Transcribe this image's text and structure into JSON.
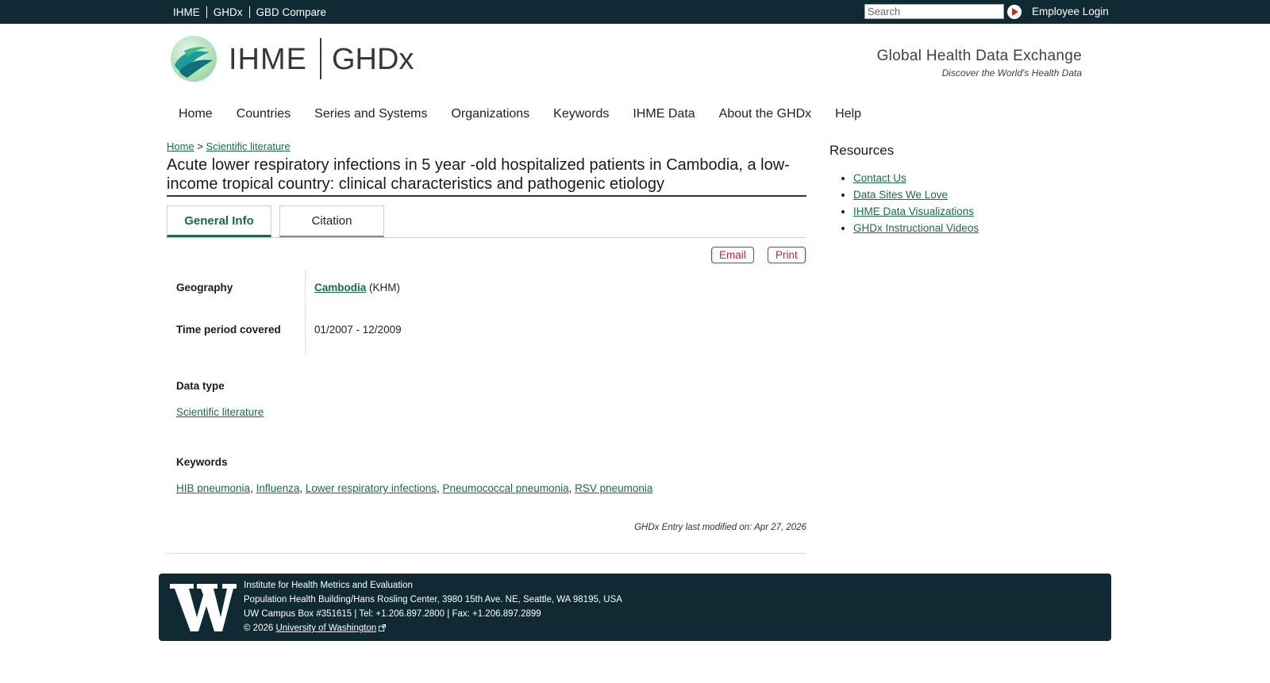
{
  "top_nav": {
    "links": [
      "IHME",
      "GHDx",
      "GBD Compare"
    ],
    "search_placeholder": "Search",
    "employee_login": "Employee Login"
  },
  "header": {
    "logo_ihme": "IHME",
    "logo_ghdx": "GHDx",
    "tagline": "Global Health Data Exchange",
    "tagline_sub": "Discover the World's Health Data"
  },
  "main_nav": [
    "Home",
    "Countries",
    "Series and Systems",
    "Organizations",
    "Keywords",
    "IHME Data",
    "About the GHDx",
    "Help"
  ],
  "breadcrumb": {
    "home": "Home",
    "separator": ">",
    "current": "Scientific literature"
  },
  "page_title": "Acute lower respiratory infections in 5 year -old hospitalized patients in Cambodia, a low-income tropical country: clinical characteristics and pathogenic etiology",
  "tabs": [
    "General Info",
    "Citation"
  ],
  "actions": {
    "email": "Email",
    "print": "Print"
  },
  "info": {
    "geography_label": "Geography",
    "geography_link": "Cambodia",
    "geography_code": "(KHM)",
    "time_label": "Time period covered",
    "time_value": "01/2007 - 12/2009"
  },
  "data_type": {
    "label": "Data type",
    "value": "Scientific literature"
  },
  "keywords": {
    "label": "Keywords",
    "items": [
      "HIB pneumonia",
      "Influenza",
      "Lower respiratory infections",
      "Pneumococcal pneumonia",
      "RSV pneumonia"
    ]
  },
  "modified": "GHDx Entry last modified on: Apr 27, 2026",
  "resources": {
    "title": "Resources",
    "items": [
      "Contact Us",
      "Data Sites We Love",
      "IHME Data Visualizations",
      "GHDx Instructional Videos"
    ]
  },
  "footer": {
    "line1": "Institute for Health Metrics and Evaluation",
    "line2": "Population Health Building/Hans Rosling Center, 3980 15th Ave. NE, Seattle, WA 98195, USA",
    "line3": "UW Campus Box #351615 | Tel: +1.206.897.2800 | Fax: +1.206.897.2899",
    "copyright": "© 2026",
    "uw_link": "University of Washington"
  },
  "colors": {
    "topbar": "#0f2a33",
    "link_green": "#1a6b4a",
    "accent_red": "#d2232a"
  }
}
